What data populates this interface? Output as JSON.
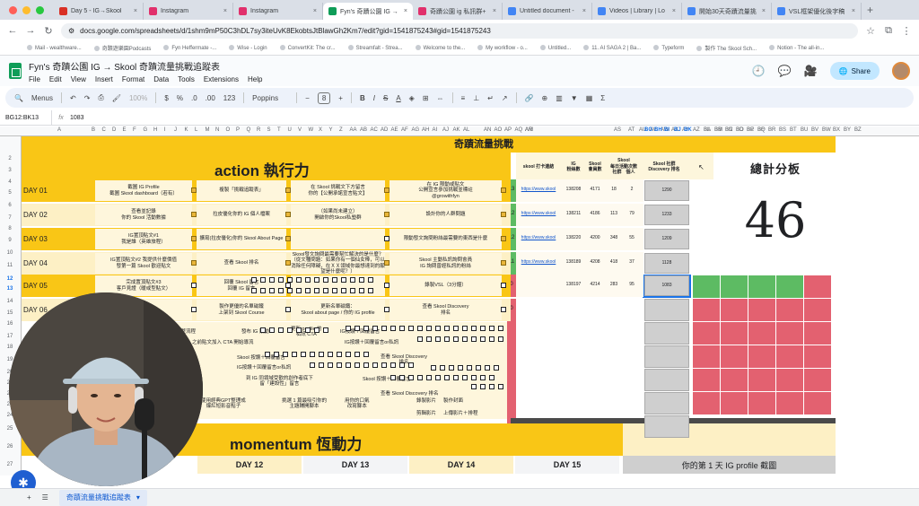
{
  "browser": {
    "tabs": [
      {
        "label": "Day 5 - IG→Skool",
        "color": "#d93025"
      },
      {
        "label": "Instagram",
        "color": "#e1306c"
      },
      {
        "label": "Instagram",
        "color": "#e1306c"
      },
      {
        "label": "Fyn's 奇蹟公園 IG →",
        "color": "#0f9d58"
      },
      {
        "label": "奇蹟公園 ig 私訊群+",
        "color": "#e1306c"
      },
      {
        "label": "Untitled document -",
        "color": "#4285f4"
      },
      {
        "label": "Videos | Library | Lo",
        "color": "#4285f4"
      },
      {
        "label": "開始30天奇蹟流量挑",
        "color": "#4285f4"
      },
      {
        "label": "VSL框架優化後字稿",
        "color": "#4285f4"
      }
    ],
    "url": "docs.google.com/spreadsheets/d/1shm9mP50C3hDL7sy3iteUvK8EkobtsJtBlawGh2Km7/edit?gid=1541875243#gid=1541875243",
    "bookmarks": [
      "Mail - wealthware...",
      "奇蹟遊樂園Podcasts",
      "Fyn Heffermate -...",
      "Wise - Login",
      "ConvertKit: The cr...",
      "Streamfalt - Strea...",
      "Welcome to the...",
      "My workflow - o...",
      "Untitled...",
      "11. AI SAGA 2 | Ba...",
      "Typeform",
      "製作 The Skool Sch...",
      "Notion - The all-in..."
    ]
  },
  "doc": {
    "title": "Fyn's 奇蹟公園 IG → Skool 奇蹟流量挑戰追蹤表",
    "menus": [
      "File",
      "Edit",
      "View",
      "Insert",
      "Format",
      "Data",
      "Tools",
      "Extensions",
      "Help"
    ],
    "share_label": "Share"
  },
  "toolbar": {
    "menus_label": "Menus",
    "zoom": "100%",
    "font": "Poppins",
    "font_size": "8",
    "num_format": "123"
  },
  "formula": {
    "namebox": "BG12:BK13",
    "value": "1083"
  },
  "columns": [
    "A",
    "B",
    "C",
    "D",
    "E",
    "F",
    "G",
    "H",
    "I",
    "J",
    "K",
    "L",
    "M",
    "N",
    "O",
    "P",
    "Q",
    "R",
    "S",
    "T",
    "U",
    "V",
    "W",
    "X",
    "Y",
    "Z",
    "AA",
    "AB",
    "AC",
    "AD",
    "AE",
    "AF",
    "AG",
    "AH",
    "AI",
    "AJ",
    "AK",
    "AL",
    "AM",
    "AN",
    "AO",
    "AP",
    "AQ",
    "AR",
    "AS",
    "AT",
    "AU",
    "AV",
    "AW",
    "AX",
    "AY",
    "AZ",
    "BA",
    "BB",
    "BC",
    "BD",
    "BE",
    "BF",
    "BG",
    "BH",
    "BI",
    "BJ",
    "BK",
    "BL",
    "BM",
    "BN",
    "BO",
    "BP",
    "BQ",
    "BR",
    "BS",
    "BT",
    "BU",
    "BV",
    "BW",
    "BX",
    "BY",
    "BZ"
  ],
  "rows": [
    "2",
    "3",
    "4",
    "5",
    "6",
    "7",
    "8",
    "9",
    "10",
    "11",
    "12",
    "13",
    "14",
    "15",
    "16",
    "17",
    "18",
    "19",
    "20",
    "21",
    "22",
    "23",
    "24",
    "25",
    "26",
    "27"
  ],
  "sheet": {
    "top_banner": "奇蹟流量挑戰",
    "action_title": "action 執行力",
    "momentum_title": "momentum 恆動力",
    "days": [
      "DAY 01",
      "DAY 02",
      "DAY 03",
      "DAY 04",
      "DAY 05",
      "DAY 06"
    ],
    "tasks": [
      [
        "截圖 IG Profile\n截圖 Skool dashboard（若有）",
        "複製「挑戰追蹤表」",
        "在 Skool 挑戰文下方留言\n你的【公開承諾宣言貼文】",
        "在 IG 限動或貼文\n公開宣言參加挑戰並標註\n@growithfyn"
      ],
      [
        "查看並記錄\n你的 Skool 活動數據",
        "拉皮優化你的 IG 個人檔案",
        "（如果尚未建立）\n開啟你的Skool私塾群",
        "設計你的人群問題"
      ],
      [
        "IG置頂貼文#1\n我是誰（英雄旅程）",
        "擴寫(拉皮優化)你的 Skool About Page",
        "",
        "限動發文詢問粉絲最需要的東西是什麼"
      ],
      [
        "IG置頂貼文#2 我提供什麼價值\n發第一篇 Skool 歡迎貼文",
        "查看 Skool 排名",
        "Skool發文詢問最需要幫忙解決的是什麼？\n（從文種問題：如果你有一個仙女棒，可以消除任何障礙，在ＸＸ領域你最想達到的願望是什麼呢？）",
        "Skool 主動私訊詢問會員\nIG 詢問曾經私訊的粉絲"
      ],
      [
        "完成置頂貼文#3\n客戶見證（暖或型貼文）",
        "回覆 Skool 留言\n回覆 IG 留言",
        "",
        "錄製VSL（3分鐘）"
      ],
      [
        "",
        "製作更優的名單磁鐵\n上架到 Skool Course",
        "更新名單磁鐵：\nSkool about page / 你的 IG profile",
        "查看 Skool Discovery\n排名"
      ]
    ],
    "extra_tasks": [
      "嘗試一次完整流程",
      "發布 IG 限動",
      "更新 profile 的\n私訊 CTA",
      "IG按讚＋回覆留言",
      "之前貼文加入 CTA 開始導流",
      "IG按讚＋回覆留言or私訊",
      "Skool 按讚＋回覆留言",
      "查看 Skool Discovery\n排名",
      "IG按讚＋回覆留言or私訊",
      "到 IG 同領域受歡的創作者底下\n留「建設性」留言",
      "Skool 按讚＋回覆留言",
      "查看 Skool Discovery 排名",
      "使用經典GPT整理成\n爆紅短影音點子",
      "挑選 1 篇最吸引你的\n主題輔開腳本",
      "用你的口氣\n改寫腳本",
      "錄製影片",
      "製作封面",
      "剪輯影片",
      "上傳影片＋排程"
    ],
    "row_totals": [
      "13",
      "12",
      "12",
      "11",
      "0",
      "0"
    ],
    "stats_headers": [
      "skool 打卡連結",
      "IG\n粉絲數",
      "Skool\n會員數",
      "Skool\n每日活動次數\n社群　個人",
      "Skool 社群\nDiscovery 排名"
    ],
    "stats": [
      {
        "link": "https://www.skool",
        "followers": "138208",
        "members": "4171",
        "community": "18",
        "personal": "2",
        "rank": "1290"
      },
      {
        "link": "https://www.skool",
        "followers": "138211",
        "members": "4186",
        "community": "113",
        "personal": "79",
        "rank": "1233"
      },
      {
        "link": "https://www.skool",
        "followers": "138220",
        "members": "4200",
        "community": "348",
        "personal": "55",
        "rank": "1209"
      },
      {
        "link": "https://www.skool",
        "followers": "138189",
        "members": "4208",
        "community": "418",
        "personal": "37",
        "rank": "1128"
      },
      {
        "link": "",
        "followers": "138197",
        "members": "4214",
        "community": "283",
        "personal": "95",
        "rank": "1083"
      }
    ],
    "scoreboard_title": "總計分板",
    "total_score": "46",
    "momentum_days": [
      "DAY 12",
      "DAY 13",
      "DAY 14",
      "DAY 15"
    ],
    "momentum_note": "你的第 1 天 IG profile 截圖"
  },
  "bottom": {
    "sheet_tab": "奇蹟流量挑戰追蹤表"
  },
  "colors": {
    "yellow": "#f9c616",
    "green": "#5dbb63",
    "red": "#e36170",
    "selection": "#1a73e8"
  }
}
